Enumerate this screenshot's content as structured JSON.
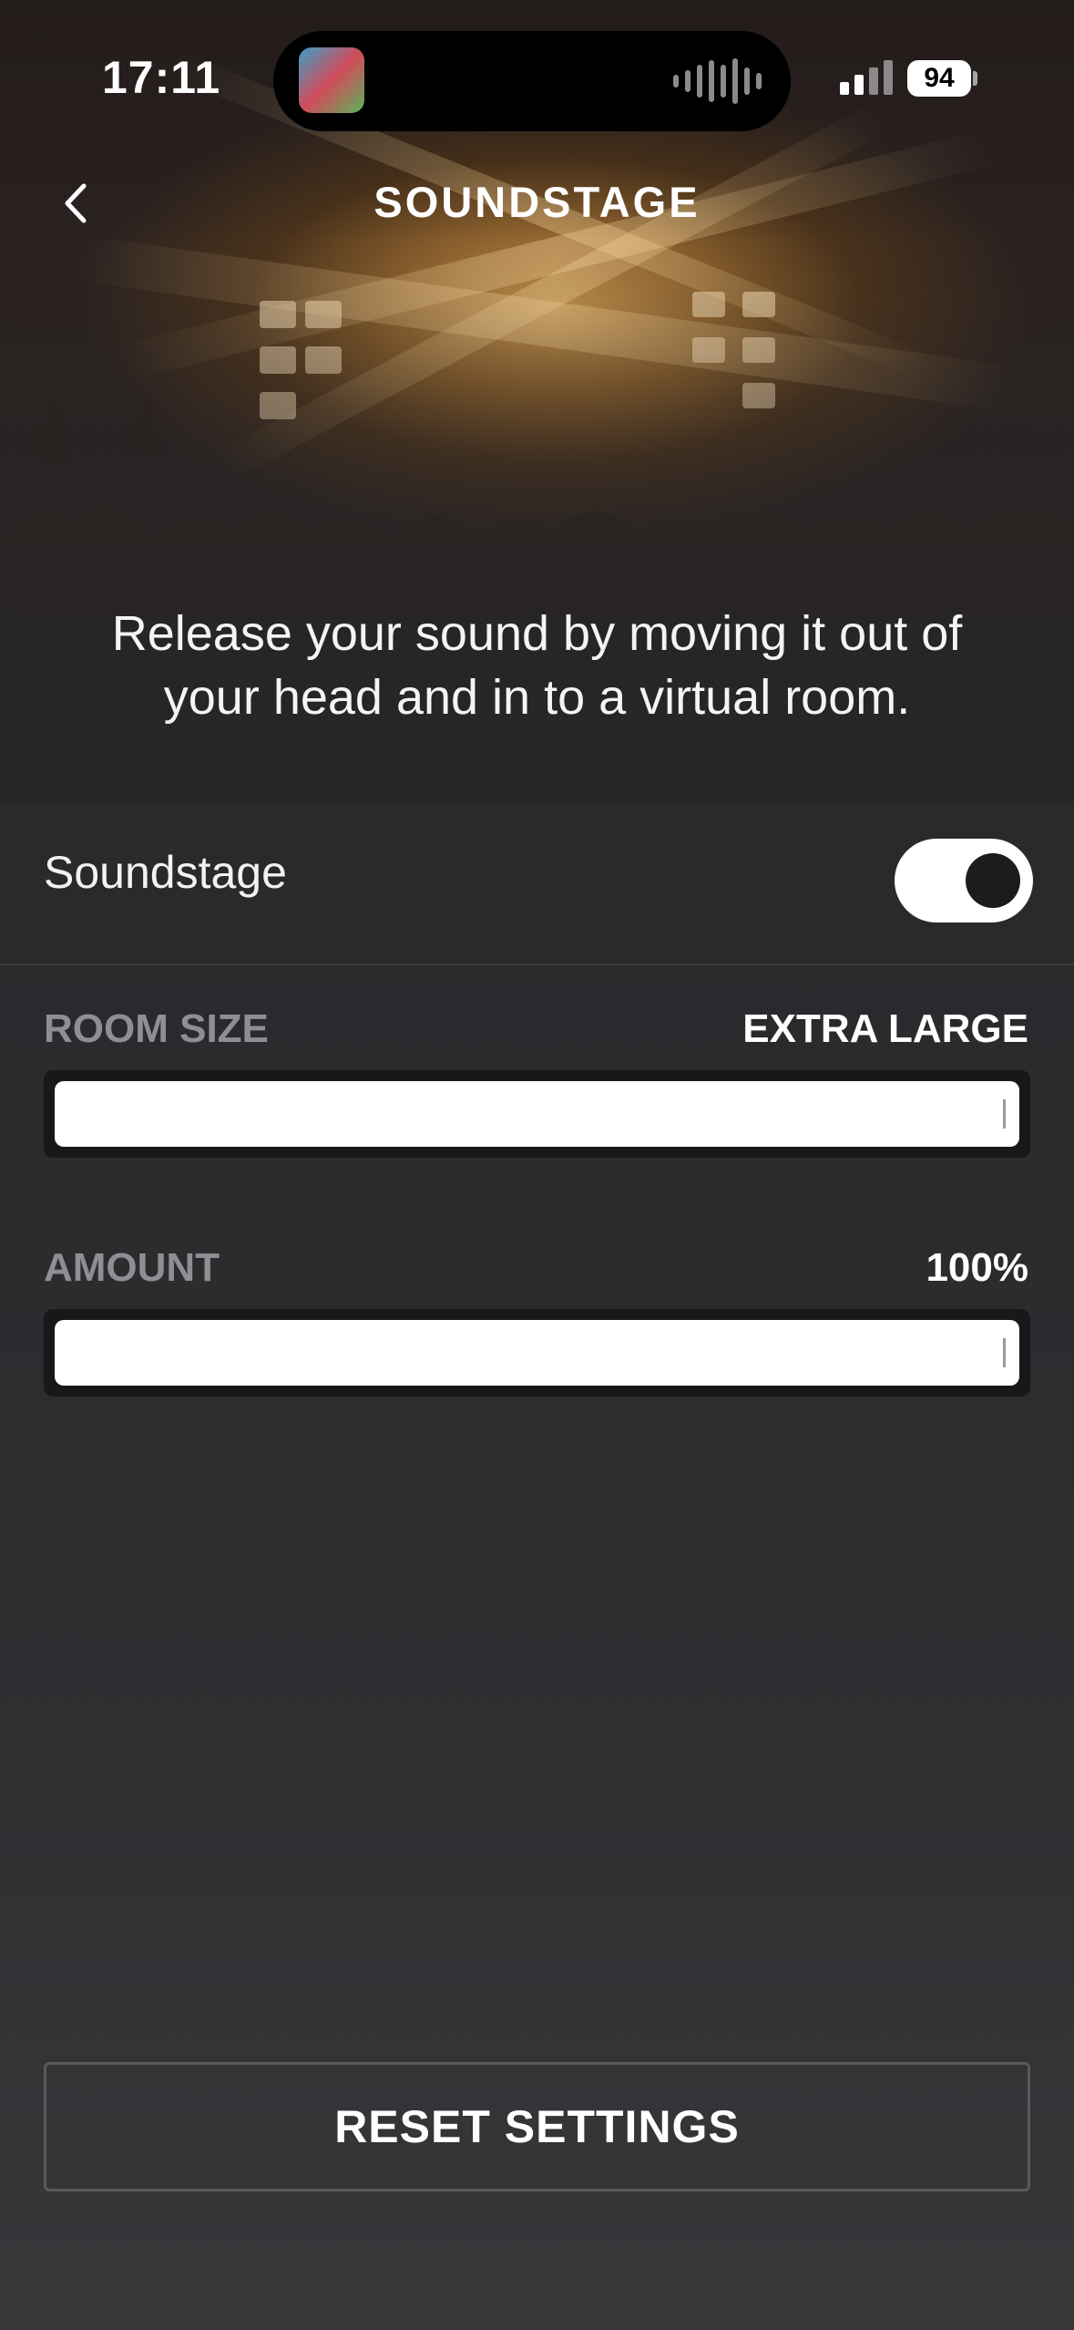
{
  "status_bar": {
    "time": "17:11",
    "battery": "94"
  },
  "header": {
    "title": "SOUNDSTAGE"
  },
  "description": "Release your sound by moving it out of your head and in to a virtual room.",
  "soundstage": {
    "label": "Soundstage",
    "enabled": true
  },
  "room_size": {
    "label": "ROOM SIZE",
    "value": "EXTRA LARGE",
    "level": 1.0
  },
  "amount": {
    "label": "AMOUNT",
    "value": "100%",
    "level": 1.0
  },
  "reset_label": "RESET SETTINGS",
  "colors": {
    "background": "#2a2a2d",
    "toggle_on": "#ffffff",
    "slider_fill": "#ffffff",
    "secondary_text": "#8e8e93"
  }
}
